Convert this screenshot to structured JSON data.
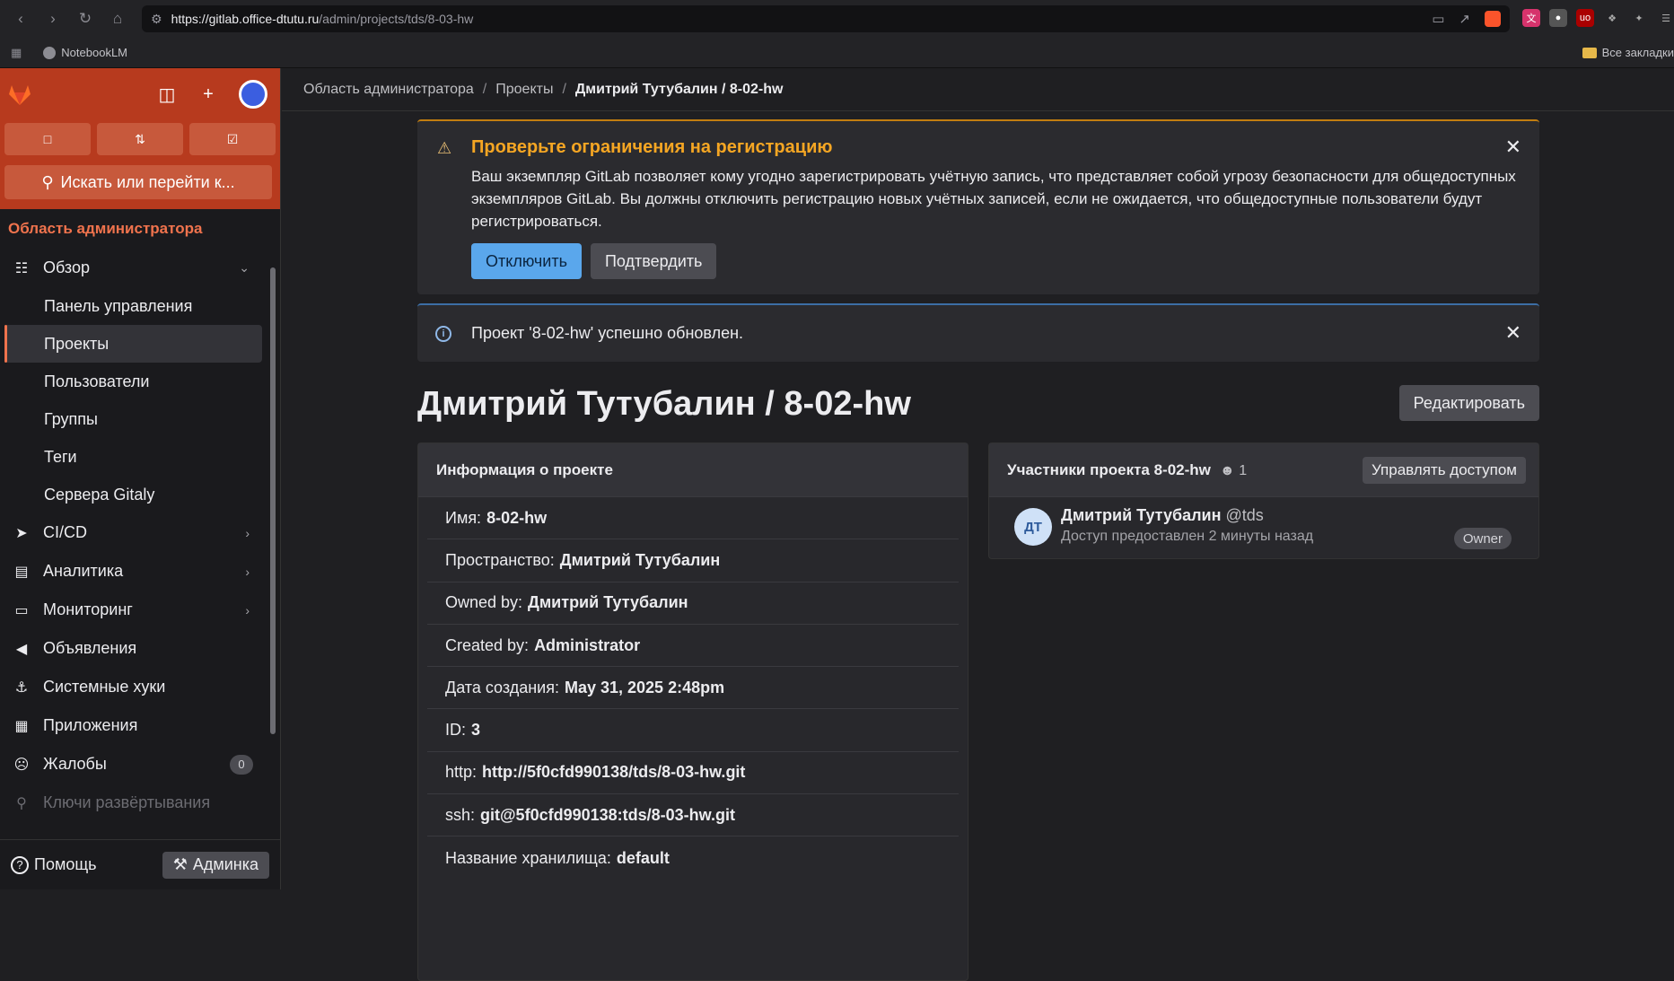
{
  "browser": {
    "url_host": "https://gitlab.office-dtutu.ru",
    "url_path": "/admin/projects/tds/8-03-hw",
    "bookmark": "NotebookLM",
    "bookmarks_right": "Все закладки"
  },
  "breadcrumb": {
    "item1": "Область администратора",
    "item2": "Проекты",
    "current": "Дмитрий Тутубалин / 8-02-hw"
  },
  "sidebar": {
    "search": "Искать или перейти к...",
    "section_title": "Область администратора",
    "items": [
      {
        "label": "Обзор",
        "icon": "overview-icon"
      },
      {
        "label": "Панель управления"
      },
      {
        "label": "Проекты"
      },
      {
        "label": "Пользователи"
      },
      {
        "label": "Группы"
      },
      {
        "label": "Теги"
      },
      {
        "label": "Сервера Gitaly"
      },
      {
        "label": "CI/CD",
        "icon": "rocket-icon"
      },
      {
        "label": "Аналитика",
        "icon": "chart-icon"
      },
      {
        "label": "Мониторинг",
        "icon": "monitor-icon"
      },
      {
        "label": "Объявления",
        "icon": "megaphone-icon"
      },
      {
        "label": "Системные хуки",
        "icon": "anchor-icon"
      },
      {
        "label": "Приложения",
        "icon": "apps-icon"
      },
      {
        "label": "Жалобы",
        "icon": "abuse-icon",
        "badge": "0"
      },
      {
        "label": "Ключи развёртывания",
        "icon": "key-icon"
      }
    ],
    "help": "Помощь",
    "admin": "Админка"
  },
  "alert_warning": {
    "title": "Проверьте ограничения на регистрацию",
    "body": "Ваш экземпляр GitLab позволяет кому угодно зарегистрировать учётную запись, что представляет собой угрозу безопасности для общедоступных экземпляров GitLab. Вы должны отключить регистрацию новых учётных записей, если не ожидается, что общедоступные пользователи будут регистрироваться.",
    "primary": "Отключить",
    "secondary": "Подтвердить"
  },
  "alert_info": {
    "text": "Проект '8-02-hw' успешно обновлен."
  },
  "page": {
    "title": "Дмитрий Тутубалин / 8-02-hw",
    "edit": "Редактировать"
  },
  "project_info": {
    "header": "Информация о проекте",
    "rows": [
      {
        "label": "Имя:",
        "value": "8-02-hw"
      },
      {
        "label": "Пространство:",
        "value": "Дмитрий Тутубалин"
      },
      {
        "label": "Owned by:",
        "value": "Дмитрий Тутубалин"
      },
      {
        "label": "Created by:",
        "value": "Administrator"
      },
      {
        "label": "Дата создания:",
        "value": "May 31, 2025 2:48pm"
      },
      {
        "label": "ID:",
        "value": "3"
      },
      {
        "label": "http:",
        "value": "http://5f0cfd990138/tds/8-03-hw.git"
      },
      {
        "label": "ssh:",
        "value": "git@5f0cfd990138:tds/8-03-hw.git"
      },
      {
        "label": "Название хранилища:",
        "value": "default"
      }
    ]
  },
  "members": {
    "header": "Участники проекта 8-02-hw",
    "count": "1",
    "manage": "Управлять доступом",
    "list": [
      {
        "initials": "ДТ",
        "name": "Дмитрий Тутубалин",
        "handle": "@tds",
        "sub": "Доступ предоставлен 2 минуты назад",
        "role": "Owner"
      }
    ]
  }
}
